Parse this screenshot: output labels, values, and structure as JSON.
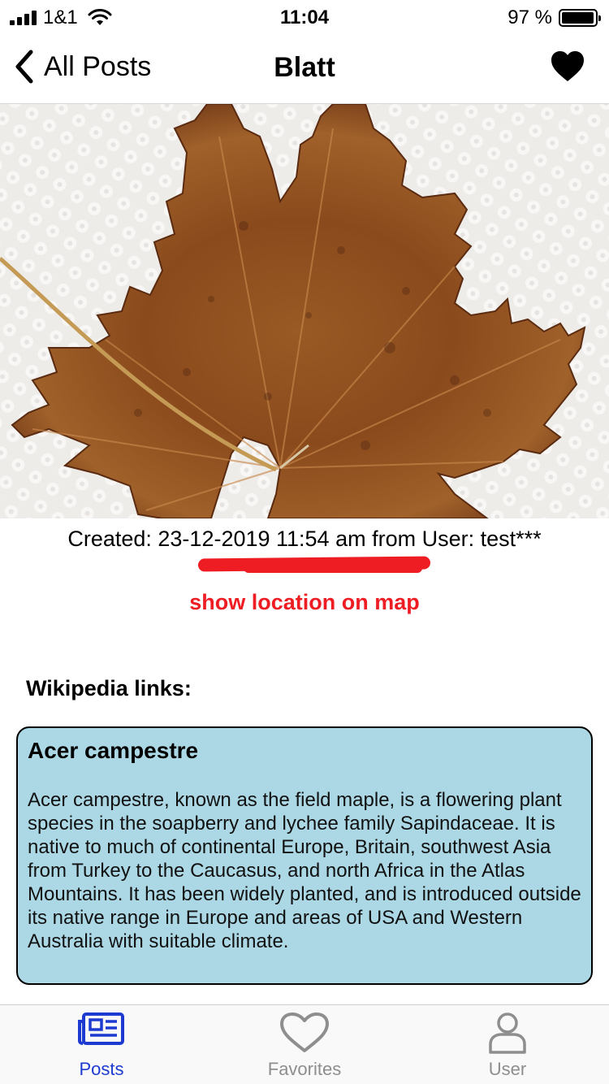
{
  "status_bar": {
    "carrier": "1&1",
    "time": "11:04",
    "battery": "97 %",
    "battery_level": 0.97
  },
  "nav": {
    "back_label": "All Posts",
    "title": "Blatt",
    "favorite_icon": "heart-filled-icon"
  },
  "post": {
    "photo_description_icon": "maple-leaf-photo",
    "created_text": "Created: 23-12-2019 11:54 am from User: test***",
    "map_link": "show location on map",
    "accent_color": "#ee1d23"
  },
  "wikipedia": {
    "heading": "Wikipedia links:",
    "cards": [
      {
        "title": "Acer campestre",
        "text": "Acer campestre, known as the field maple, is a flowering plant species in the soapberry and lychee family Sapindaceae. It is native to much of continental Europe, Britain, southwest Asia from Turkey to the Caucasus, and north Africa in the Atlas Mountains. It has been widely planted, and is introduced outside its native range in Europe and areas of USA and Western Australia with suitable climate.",
        "background": "#acd8e5"
      }
    ]
  },
  "tab_bar": {
    "tabs": [
      {
        "label": "Posts",
        "icon": "newspaper-icon",
        "active": true
      },
      {
        "label": "Favorites",
        "icon": "heart-outline-icon",
        "active": false
      },
      {
        "label": "User",
        "icon": "user-icon",
        "active": false
      }
    ],
    "active_color": "#1d3bd1"
  }
}
